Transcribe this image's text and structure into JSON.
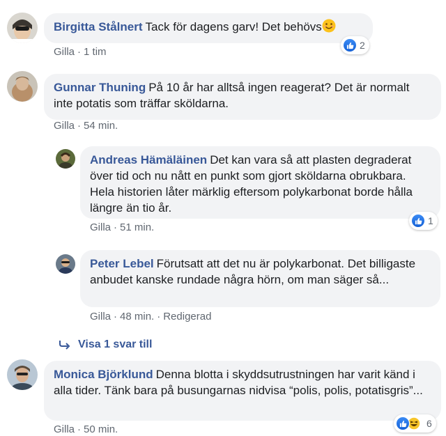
{
  "comments": [
    {
      "author": "Birgitta Stålnert",
      "text": "Tack för dagens garv! Det behövs",
      "like": "Gilla",
      "time": "1 tim",
      "reaction_count": "2"
    },
    {
      "author": "Gunnar Thuning",
      "text": "På 10 år har alltså ingen reagerat? Det är normalt inte potatis som träffar sköldarna.",
      "like": "Gilla",
      "time": "54 min."
    },
    {
      "author": "Andreas Hämäläinen",
      "text": "Det kan vara så att plasten degraderat över tid och nu nått en punkt som gjort sköldarna obrukbara. Hela historien låter märklig eftersom polykarbonat borde hålla längre än tio år.",
      "like": "Gilla",
      "time": "51 min.",
      "reaction_count": "1"
    },
    {
      "author": "Peter Lebel",
      "text": "Förutsatt att det nu är polykarbonat. Det billigaste anbudet kanske rundade några hörn, om man säger så...",
      "like": "Gilla",
      "time": "48 min.",
      "edited": "Redigerad"
    },
    {
      "author": "Monica Björklund",
      "text": "Denna blotta i skyddsutrustningen har varit känd i alla tider. Tänk bara på busungarnas nidvisa “polis, polis, potatisgris”...",
      "like": "Gilla",
      "time": "50 min.",
      "reaction_count": "6"
    }
  ],
  "view_more_replies": "Visa 1 svar till",
  "colors": {
    "author": "#385898",
    "bubble": "#f2f3f5",
    "meta": "#606770",
    "like_blue": "#1877f2"
  },
  "icons": {
    "like": "thumbs-up-icon",
    "haha": "laughing-face-icon",
    "smile": "smiling-face-icon",
    "reply_arrow": "reply-arrow-icon"
  }
}
